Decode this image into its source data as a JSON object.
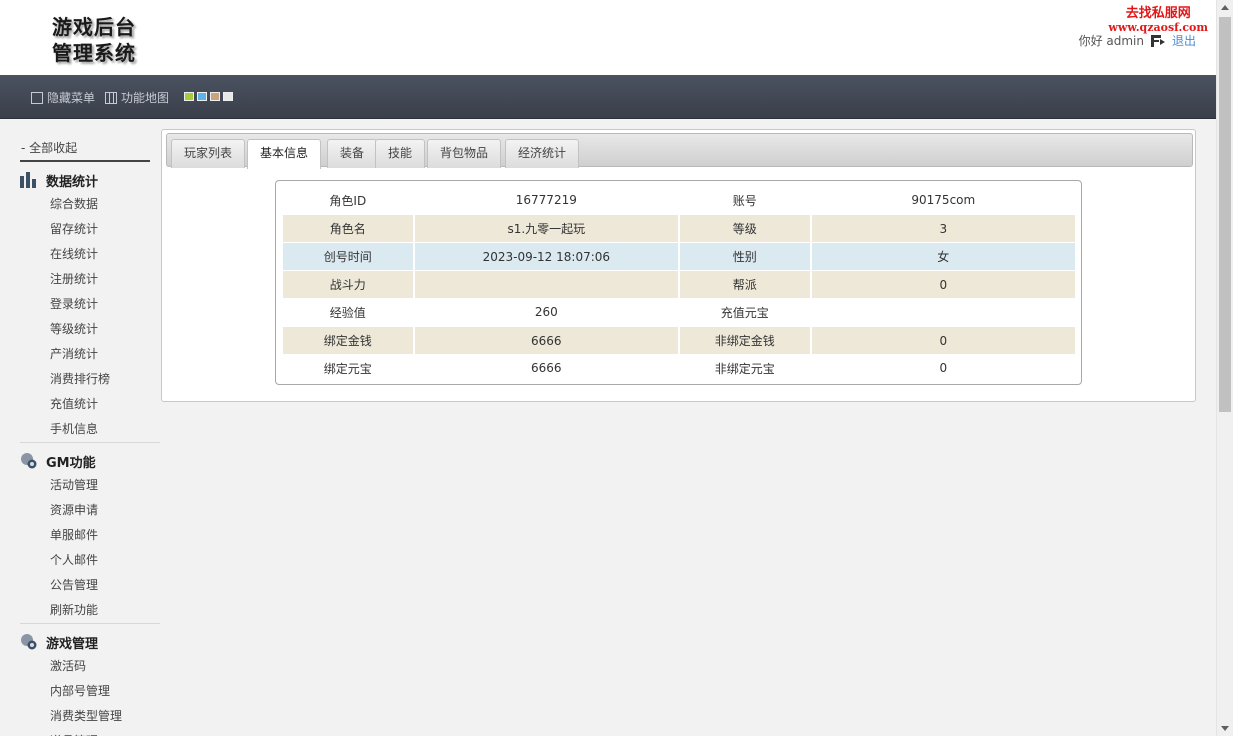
{
  "header": {
    "logo_line1": "游戏后台",
    "logo_line2": "管理系统",
    "watermark_line1": "去找私服网",
    "watermark_line2": "www.qzaosf.com",
    "greeting": "你好 admin",
    "logout_label": "退出"
  },
  "navbar": {
    "hide_menu_label": "隐藏菜单",
    "function_map_label": "功能地图",
    "theme_colors": [
      "#a6cc3a",
      "#5fb4e6",
      "#c8a57e",
      "#e8e8e8"
    ]
  },
  "sidebar": {
    "collapse_all_label": "- 全部收起",
    "sections": [
      {
        "title": "数据统计",
        "icon": "bar-chart-icon",
        "items": [
          "综合数据",
          "留存统计",
          "在线统计",
          "注册统计",
          "登录统计",
          "等级统计",
          "产消统计",
          "消费排行榜",
          "充值统计",
          "手机信息"
        ]
      },
      {
        "title": "GM功能",
        "icon": "gear-bubble-icon",
        "items": [
          "活动管理",
          "资源申请",
          "单服邮件",
          "个人邮件",
          "公告管理",
          "刷新功能"
        ]
      },
      {
        "title": "游戏管理",
        "icon": "gear-bubble-icon",
        "items": [
          "激活码",
          "内部号管理",
          "消费类型管理",
          "道具管理"
        ]
      }
    ]
  },
  "tabs": [
    "玩家列表",
    "基本信息",
    "装备",
    "技能",
    "背包物品",
    "经济统计"
  ],
  "active_tab": "基本信息",
  "info_rows": [
    [
      "角色ID",
      "16777219",
      "账号",
      "90175com"
    ],
    [
      "角色名",
      "s1.九零一起玩",
      "等级",
      "3"
    ],
    [
      "创号时间",
      "2023-09-12 18:07:06",
      "性别",
      "女"
    ],
    [
      "战斗力",
      "",
      "帮派",
      "0"
    ],
    [
      "经验值",
      "260",
      "充值元宝",
      ""
    ],
    [
      "绑定金钱",
      "6666",
      "非绑定金钱",
      "0"
    ],
    [
      "绑定元宝",
      "6666",
      "非绑定元宝",
      "0"
    ]
  ]
}
